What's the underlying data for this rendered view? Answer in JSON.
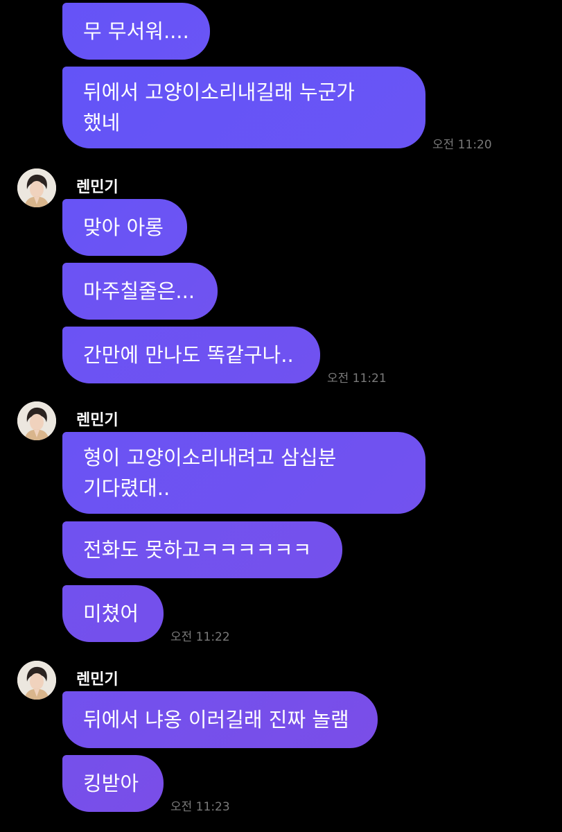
{
  "colors": {
    "background": "#000000",
    "bubble_gradient_start": "#6a55f5",
    "bubble_gradient_end": "#7a4ee8",
    "time_text": "#7a7a7a",
    "name_text": "#ffffff"
  },
  "messages": [
    {
      "text": "무 무서워...."
    },
    {
      "line1": "뒤에서 고양이소리내길래 누군가",
      "line2": "했네",
      "time": "오전 11:20"
    },
    {
      "sender": "렌민기",
      "avatar_icon": "profile-photo-icon"
    },
    {
      "text": "맞아 아롱"
    },
    {
      "text": "마주칠줄은..."
    },
    {
      "text": "간만에 만나도 똑같구나..",
      "time": "오전 11:21"
    },
    {
      "sender": "렌민기",
      "avatar_icon": "profile-photo-icon"
    },
    {
      "line1": "형이 고양이소리내려고 삼십분",
      "line2": "기다렸대.."
    },
    {
      "text": "전화도 못하고ㅋㅋㅋㅋㅋㅋ"
    },
    {
      "text": "미쳤어",
      "time": "오전 11:22"
    },
    {
      "sender": "렌민기",
      "avatar_icon": "profile-photo-icon"
    },
    {
      "text": "뒤에서 냐옹 이러길래 진짜 놀램"
    },
    {
      "text": "킹받아",
      "time": "오전 11:23"
    }
  ]
}
